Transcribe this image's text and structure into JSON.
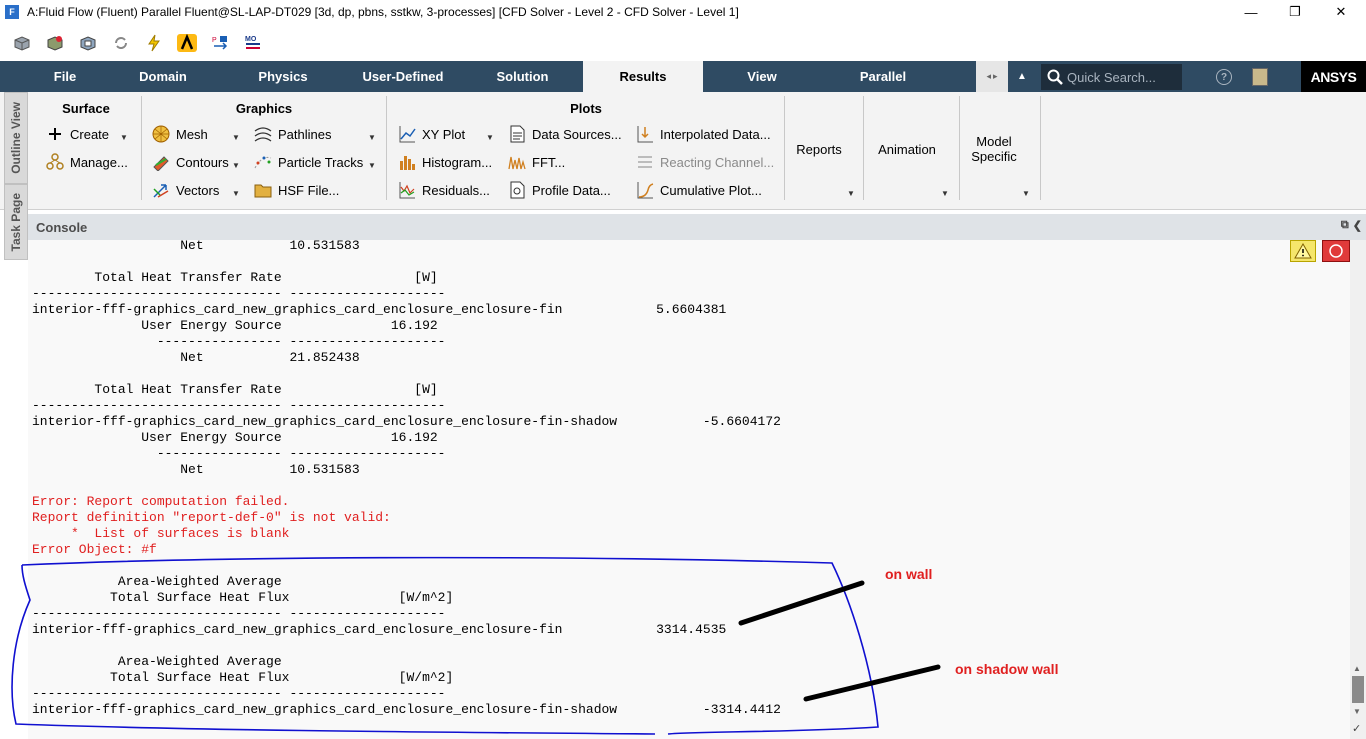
{
  "window": {
    "title": "A:Fluid Flow (Fluent) Parallel Fluent@SL-LAP-DT029  [3d, dp, pbns, sstkw, 3-processes] [CFD Solver - Level 2 - CFD Solver - Level 1]",
    "app_icon_letter": "F",
    "minimize": "—",
    "maximize": "❐",
    "close": "✕"
  },
  "tabs": [
    {
      "label": "File"
    },
    {
      "label": "Domain"
    },
    {
      "label": "Physics"
    },
    {
      "label": "User-Defined"
    },
    {
      "label": "Solution"
    },
    {
      "label": "Results",
      "active": true
    },
    {
      "label": "View"
    },
    {
      "label": "Parallel"
    }
  ],
  "search": {
    "placeholder": "Quick Search..."
  },
  "help_icon": "?",
  "brand": {
    "logo_text": "ANSYS"
  },
  "side_tabs": {
    "outline": "Outline View",
    "task": "Task Page"
  },
  "ribbon": {
    "surface": {
      "title": "Surface",
      "create": "Create",
      "manage": "Manage..."
    },
    "graphics": {
      "title": "Graphics",
      "mesh": "Mesh",
      "contours": "Contours",
      "vectors": "Vectors",
      "pathlines": "Pathlines",
      "particle_tracks": "Particle Tracks",
      "hsf_file": "HSF File..."
    },
    "plots": {
      "title": "Plots",
      "xy_plot": "XY Plot",
      "histogram": "Histogram...",
      "residuals": "Residuals...",
      "data_sources": "Data Sources...",
      "fft": "FFT...",
      "profile_data": "Profile Data...",
      "interpolated_data": "Interpolated Data...",
      "reacting_channel": "Reacting Channel...",
      "cumulative_plot": "Cumulative Plot..."
    },
    "reports": "Reports",
    "animation": "Animation",
    "model_specific": {
      "line1": "Model",
      "line2": "Specific"
    }
  },
  "console": {
    "title": "Console",
    "lines": [
      {
        "text": "                   Net           10.531583",
        "type": "normal"
      },
      {
        "text": "",
        "type": "normal"
      },
      {
        "text": "        Total Heat Transfer Rate                 [W]",
        "type": "normal"
      },
      {
        "text": "-------------------------------- --------------------",
        "type": "normal"
      },
      {
        "text": "interior-fff-graphics_card_new_graphics_card_enclosure_enclosure-fin            5.6604381",
        "type": "normal"
      },
      {
        "text": "              User Energy Source              16.192",
        "type": "normal"
      },
      {
        "text": "                ---------------- --------------------",
        "type": "normal"
      },
      {
        "text": "                   Net           21.852438",
        "type": "normal"
      },
      {
        "text": "",
        "type": "normal"
      },
      {
        "text": "        Total Heat Transfer Rate                 [W]",
        "type": "normal"
      },
      {
        "text": "-------------------------------- --------------------",
        "type": "normal"
      },
      {
        "text": "interior-fff-graphics_card_new_graphics_card_enclosure_enclosure-fin-shadow           -5.6604172",
        "type": "normal"
      },
      {
        "text": "              User Energy Source              16.192",
        "type": "normal"
      },
      {
        "text": "                ---------------- --------------------",
        "type": "normal"
      },
      {
        "text": "                   Net           10.531583",
        "type": "normal"
      },
      {
        "text": "",
        "type": "normal"
      },
      {
        "text": "Error: Report computation failed.",
        "type": "error"
      },
      {
        "text": "Report definition \"report-def-0\" is not valid:",
        "type": "error"
      },
      {
        "text": "     *  List of surfaces is blank",
        "type": "error"
      },
      {
        "text": "Error Object: #f",
        "type": "error"
      },
      {
        "text": "",
        "type": "normal"
      },
      {
        "text": "           Area-Weighted Average",
        "type": "normal"
      },
      {
        "text": "          Total Surface Heat Flux              [W/m^2]",
        "type": "normal"
      },
      {
        "text": "-------------------------------- --------------------",
        "type": "normal"
      },
      {
        "text": "interior-fff-graphics_card_new_graphics_card_enclosure_enclosure-fin            3314.4535",
        "type": "normal"
      },
      {
        "text": "",
        "type": "normal"
      },
      {
        "text": "           Area-Weighted Average",
        "type": "normal"
      },
      {
        "text": "          Total Surface Heat Flux              [W/m^2]",
        "type": "normal"
      },
      {
        "text": "-------------------------------- --------------------",
        "type": "normal"
      },
      {
        "text": "interior-fff-graphics_card_new_graphics_card_enclosure_enclosure-fin-shadow           -3314.4412",
        "type": "normal"
      }
    ]
  },
  "annotations": {
    "on_wall": "on wall",
    "on_shadow_wall": "on shadow wall",
    "color": "#e02020",
    "ink_color": "#1010d0"
  },
  "colors": {
    "tab_bar": "#2f4b63",
    "ribbon_bg": "#f3f3f3",
    "error_text": "#e02020"
  }
}
